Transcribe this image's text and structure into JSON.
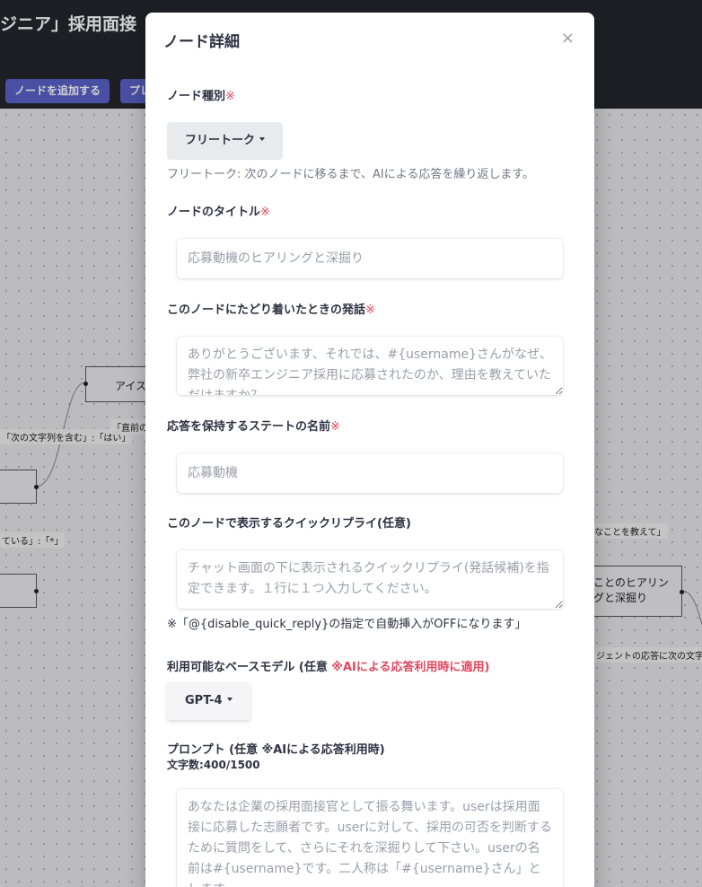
{
  "app": {
    "title": "ジニア」採用面接",
    "add_node_button": "ノードを追加する",
    "second_button": "プレ"
  },
  "canvas": {
    "nodes": [
      {
        "label": "アイス"
      },
      {
        "label": ""
      },
      {
        "label": ""
      },
      {
        "label": "ことのヒアリン\nグと深掘り"
      }
    ],
    "edge_labels": [
      "「次の文字列を含む」:「はい」",
      "「直前の",
      "ている」:「*」",
      "なことを教えて」",
      "ジェントの応答に次の文字"
    ]
  },
  "modal": {
    "title": "ノード詳細",
    "close": "×",
    "required_mark": "※",
    "node_type": {
      "label": "ノード種別",
      "value": "フリートーク",
      "hint": "フリートーク: 次のノードに移るまで、AIによる応答を繰り返します。"
    },
    "node_title": {
      "label": "ノードのタイトル",
      "placeholder": "応募動機のヒアリングと深掘り"
    },
    "arrival_utterance": {
      "label": "このノードにたどり着いたときの発話",
      "placeholder": "ありがとうございます、それでは、#{username}さんがなぜ、弊社の新卒エンジニア採用に応募されたのか、理由を教えていただけますか？"
    },
    "state_name": {
      "label": "応答を保持するステートの名前",
      "placeholder": "応募動機"
    },
    "quick_reply": {
      "label": "このノードで表示するクイックリプライ(任意)",
      "placeholder": "チャット画面の下に表示されるクイックリプライ(発話候補)を指定できます。１行に１つ入力してください。",
      "note": "※「@{disable_quick_reply}の指定で自動挿入がOFFになります」"
    },
    "base_model": {
      "label_prefix": "利用可能なベースモデル (任意 ",
      "label_mark": "※AIによる応答利用時に適用)",
      "value": "GPT-4"
    },
    "prompt": {
      "label": "プロンプト (任意 ※AIによる応答利用時)",
      "char_count": "文字数:400/1500",
      "placeholder": "あなたは企業の採用面接官として振る舞います。userは採用面接に応募した志願者です。userに対して、採用の可否を判断するために質問をして、さらにそれを深掘りして下さい。userの名前は#{username}です。二人称は「#{username}さん」とします。"
    }
  }
}
